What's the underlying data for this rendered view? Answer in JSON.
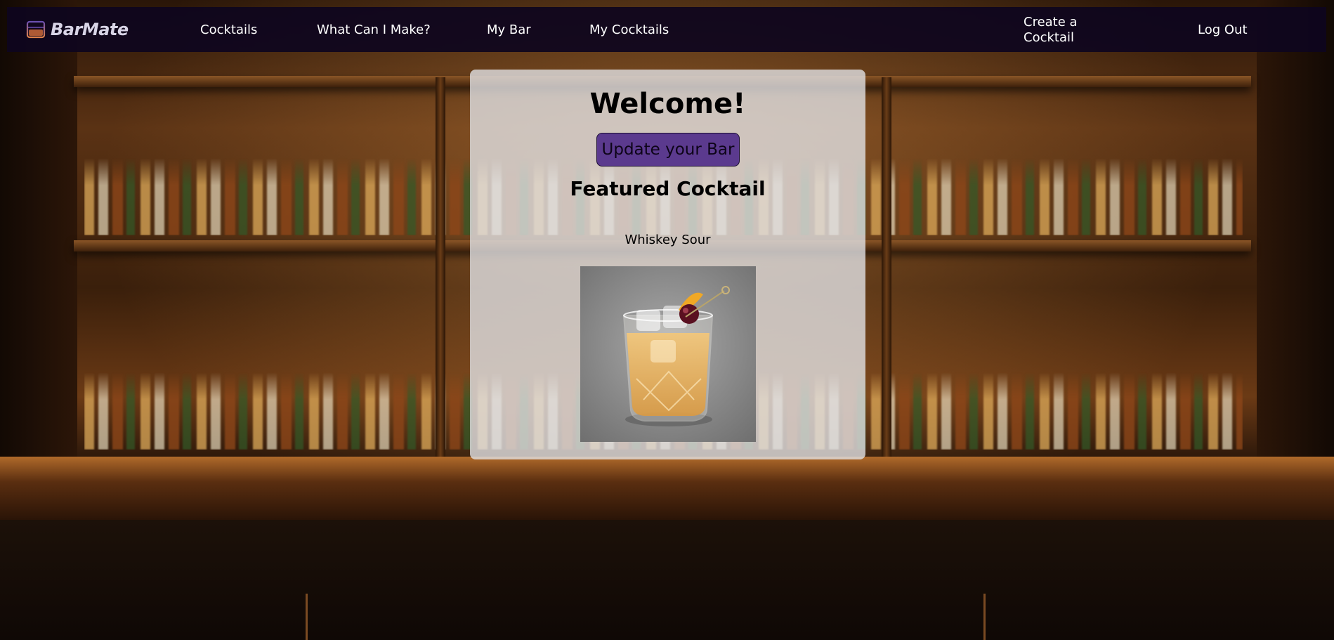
{
  "brand": {
    "name": "BarMate",
    "icon": "glass-icon",
    "accent": "#5b3a8e"
  },
  "nav": {
    "cocktails": "Cocktails",
    "what_can_i_make": "What Can I Make?",
    "my_bar": "My Bar",
    "my_cocktails": "My Cocktails",
    "create_cocktail": "Create a Cocktail",
    "log_out": "Log Out"
  },
  "main": {
    "welcome": "Welcome!",
    "update_button": "Update your Bar",
    "featured_heading": "Featured Cocktail",
    "featured_name": "Whiskey Sour",
    "featured_image_alt": "Whiskey Sour"
  },
  "colors": {
    "nav_bg": "#0e051e",
    "button_bg": "#5b3a8e",
    "card_bg": "#e1e1e4"
  }
}
